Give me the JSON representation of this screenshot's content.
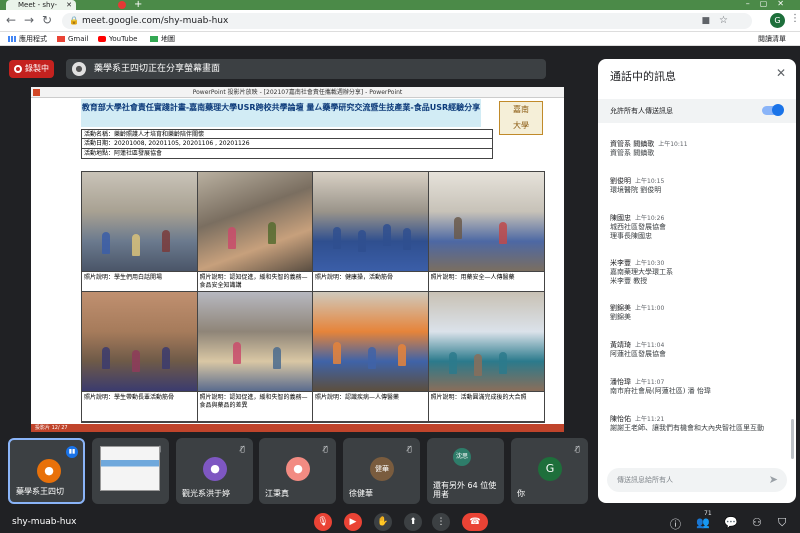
{
  "browser": {
    "tab_title": "Meet - shy-muab-hux",
    "url": "meet.google.com/shy-muab-hux",
    "profile_initial": "G",
    "bookmarks": [
      "應用程式",
      "Gmail",
      "YouTube",
      "地圖"
    ],
    "reading_list": "閱讀清單"
  },
  "meet": {
    "recording_label": "錄製中",
    "share_banner": "藥學系王四切正在分享螢幕畫面",
    "meeting_code": "shy-muab-hux",
    "participants_count": "71"
  },
  "presentation": {
    "window_title": "PowerPoint 投影片放映 - [202107嘉南社會責任攜載週辦分享] - PowerPoint",
    "status_text": "投影片 12/ 27",
    "slide": {
      "title": "教育部大學社會責任實踐計畫-嘉南藥理大學USR跨校共學論壇 量ㄙ藥學研究交流暨生技產業-食品USR經驗分享",
      "logo_text": "嘉南\n大學",
      "info_rows": [
        "活動名稱：樂齡照護人才培育和樂齡陪伴關懷",
        "活動日期：20201008, 20201105, 20201106 , 20201126",
        "活動地點：阿蓮社區發展協會"
      ],
      "captions": [
        "照片說明：學生們用白話開場",
        "照片說明：認知促進，緩和失智的義務—食品安全知識講",
        "照片說明：健康操，活動筋骨",
        "照片說明：用藥安全—人傳醫藥",
        "照片說明：學生帶動長輩活動筋骨",
        "照片說明：認知促進，緩和失智的義務—食品與藥品的差異",
        "照片說明：認識疾病—人傳醫藥",
        "照片說明：活動圓滿完成後的大合照"
      ]
    }
  },
  "participants": [
    {
      "name": "藥學系王四切",
      "initial": "",
      "color": "#e8710a"
    },
    {
      "name": "",
      "initial": "",
      "color": ""
    },
    {
      "name": "觀光系洪于婷",
      "initial": "",
      "color": "#7e57c2"
    },
    {
      "name": "江秉真",
      "initial": "",
      "color": "#f28b82"
    },
    {
      "name": "徐健華",
      "initial": "健華",
      "color": "#7a5c3e"
    },
    {
      "name": "還有另外 64 位使用者",
      "initial": "沈思",
      "color": "#2e7d6a"
    },
    {
      "name": "你",
      "initial": "G",
      "color": "#1e6f3b"
    }
  ],
  "chat": {
    "title": "通話中的訊息",
    "allow_label": "允許所有人傳送訊息",
    "input_placeholder": "傳送訊息給所有人",
    "messages": [
      {
        "sender": "資管系 闕鎮歌",
        "time": "上午10:11",
        "text": "資管系 闕鎮歌"
      },
      {
        "sender": "劉俊明",
        "time": "上午10:15",
        "text": "環境醫院 劉俊明"
      },
      {
        "sender": "陳國忠",
        "time": "上午10:26",
        "text": "城西社區發展協會\n理事長陳國忠"
      },
      {
        "sender": "米李豐",
        "time": "上午10:30",
        "text": "嘉南藥理大學環工系\n米李豐 教授"
      },
      {
        "sender": "劉錦美",
        "time": "上午11:00",
        "text": "劉錦美"
      },
      {
        "sender": "黃靖琦",
        "time": "上午11:04",
        "text": "阿蓮社區發展協會"
      },
      {
        "sender": "潘怡瑋",
        "time": "上午11:07",
        "text": "南市府社會局(阿蓮社區) 潘 怡瑋"
      },
      {
        "sender": "陳怡佑",
        "time": "上午11:21",
        "text": "謝謝王老師、讓我們有機會和大內央智社區里互動"
      }
    ]
  }
}
